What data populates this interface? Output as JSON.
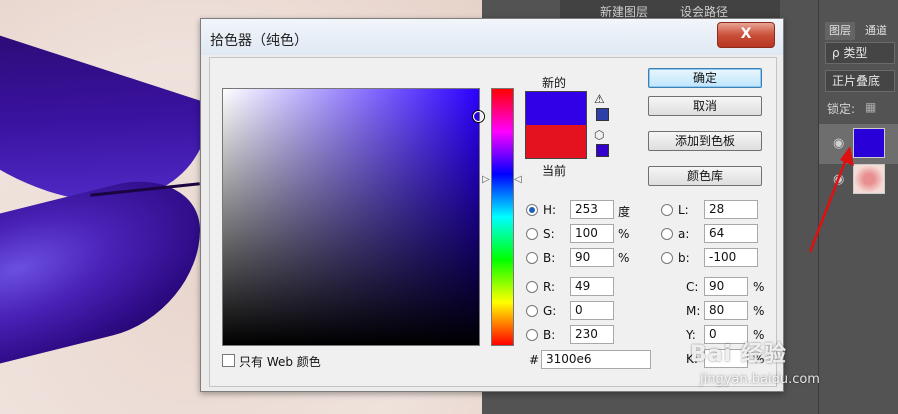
{
  "dialog": {
    "title": "拾色器（纯色）",
    "close_label": "X",
    "new_label": "新的",
    "current_label": "当前",
    "buttons": {
      "ok": "确定",
      "cancel": "取消",
      "add_to_swatches": "添加到色板",
      "color_libraries": "颜色库"
    },
    "hsb": {
      "h": {
        "label": "H:",
        "value": "253",
        "unit": "度"
      },
      "s": {
        "label": "S:",
        "value": "100",
        "unit": "%"
      },
      "b": {
        "label": "B:",
        "value": "90",
        "unit": "%"
      }
    },
    "lab": {
      "l": {
        "label": "L:",
        "value": "28"
      },
      "a": {
        "label": "a:",
        "value": "64"
      },
      "b": {
        "label": "b:",
        "value": "-100"
      }
    },
    "rgb": {
      "r": {
        "label": "R:",
        "value": "49"
      },
      "g": {
        "label": "G:",
        "value": "0"
      },
      "b": {
        "label": "B:",
        "value": "230"
      }
    },
    "cmyk": {
      "c": {
        "label": "C:",
        "value": "90",
        "unit": "%"
      },
      "m": {
        "label": "M:",
        "value": "80",
        "unit": "%"
      },
      "y": {
        "label": "Y:",
        "value": "0",
        "unit": "%"
      },
      "k": {
        "label": "K:",
        "unit": "%"
      }
    },
    "web_only_label": "只有 Web 颜色",
    "hash_label": "#",
    "hex_value": "3100e6",
    "new_color": "#3100e6",
    "current_color": "#e3121e"
  },
  "top_strip": {
    "item1": "新建图层",
    "item2": "设会路径"
  },
  "layers_panel": {
    "tab_layers": "图层",
    "tab_channels": "通道",
    "filter_label": "ρ 类型",
    "blend_mode": "正片叠底",
    "lock_label": "锁定:"
  },
  "watermark": {
    "brand": "Bai 经验",
    "url": "jingyan.baidu.com"
  }
}
